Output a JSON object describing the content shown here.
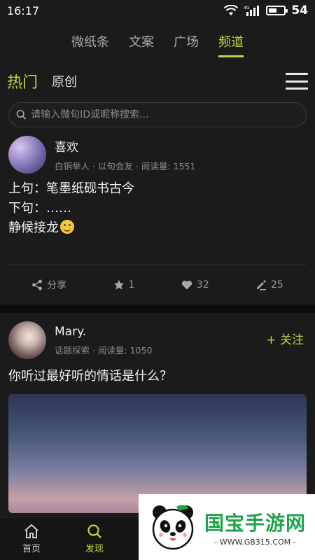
{
  "status": {
    "time": "16:17",
    "network": "4G",
    "battery": "54",
    "battery_level": 0.54
  },
  "top_tabs": [
    {
      "label": "微纸条",
      "active": false
    },
    {
      "label": "文案",
      "active": false
    },
    {
      "label": "广场",
      "active": false
    },
    {
      "label": "频道",
      "active": true
    }
  ],
  "sub_tabs": {
    "hot": "热门",
    "original": "原创"
  },
  "search": {
    "placeholder": "请输入微句ID或昵称搜索..."
  },
  "posts": [
    {
      "name": "喜欢",
      "meta": "白铜举人 · 以句会友 · 阅读量: 1551",
      "lines": [
        "上句：笔墨纸砚书古今",
        "下句：……",
        "静候接龙"
      ],
      "actions": {
        "share": "分享",
        "favorites": "1",
        "likes": "32",
        "comments": "25"
      }
    },
    {
      "name": "Mary.",
      "meta": "话题探索 · 阅读量: 1050",
      "follow": "+ 关注",
      "question": "你听过最好听的情话是什么？"
    }
  ],
  "bottom_nav": [
    {
      "label": "首页",
      "icon": "home-icon",
      "active": false
    },
    {
      "label": "发现",
      "icon": "search-icon",
      "active": true
    }
  ],
  "watermark": {
    "title": "国宝手游网",
    "url": "- WWW.GB315.COM -"
  },
  "colors": {
    "accent": "#b8d940",
    "background": "#1b1b1b",
    "watermark_green": "#1ea34b"
  }
}
